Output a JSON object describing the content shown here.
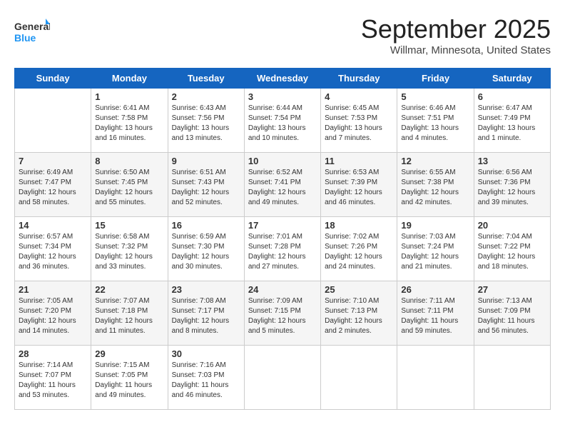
{
  "header": {
    "logo_general": "General",
    "logo_blue": "Blue",
    "month_title": "September 2025",
    "location": "Willmar, Minnesota, United States"
  },
  "days_of_week": [
    "Sunday",
    "Monday",
    "Tuesday",
    "Wednesday",
    "Thursday",
    "Friday",
    "Saturday"
  ],
  "weeks": [
    [
      {
        "date": "",
        "sunrise": "",
        "sunset": "",
        "daylight": ""
      },
      {
        "date": "1",
        "sunrise": "Sunrise: 6:41 AM",
        "sunset": "Sunset: 7:58 PM",
        "daylight": "Daylight: 13 hours and 16 minutes."
      },
      {
        "date": "2",
        "sunrise": "Sunrise: 6:43 AM",
        "sunset": "Sunset: 7:56 PM",
        "daylight": "Daylight: 13 hours and 13 minutes."
      },
      {
        "date": "3",
        "sunrise": "Sunrise: 6:44 AM",
        "sunset": "Sunset: 7:54 PM",
        "daylight": "Daylight: 13 hours and 10 minutes."
      },
      {
        "date": "4",
        "sunrise": "Sunrise: 6:45 AM",
        "sunset": "Sunset: 7:53 PM",
        "daylight": "Daylight: 13 hours and 7 minutes."
      },
      {
        "date": "5",
        "sunrise": "Sunrise: 6:46 AM",
        "sunset": "Sunset: 7:51 PM",
        "daylight": "Daylight: 13 hours and 4 minutes."
      },
      {
        "date": "6",
        "sunrise": "Sunrise: 6:47 AM",
        "sunset": "Sunset: 7:49 PM",
        "daylight": "Daylight: 13 hours and 1 minute."
      }
    ],
    [
      {
        "date": "7",
        "sunrise": "Sunrise: 6:49 AM",
        "sunset": "Sunset: 7:47 PM",
        "daylight": "Daylight: 12 hours and 58 minutes."
      },
      {
        "date": "8",
        "sunrise": "Sunrise: 6:50 AM",
        "sunset": "Sunset: 7:45 PM",
        "daylight": "Daylight: 12 hours and 55 minutes."
      },
      {
        "date": "9",
        "sunrise": "Sunrise: 6:51 AM",
        "sunset": "Sunset: 7:43 PM",
        "daylight": "Daylight: 12 hours and 52 minutes."
      },
      {
        "date": "10",
        "sunrise": "Sunrise: 6:52 AM",
        "sunset": "Sunset: 7:41 PM",
        "daylight": "Daylight: 12 hours and 49 minutes."
      },
      {
        "date": "11",
        "sunrise": "Sunrise: 6:53 AM",
        "sunset": "Sunset: 7:39 PM",
        "daylight": "Daylight: 12 hours and 46 minutes."
      },
      {
        "date": "12",
        "sunrise": "Sunrise: 6:55 AM",
        "sunset": "Sunset: 7:38 PM",
        "daylight": "Daylight: 12 hours and 42 minutes."
      },
      {
        "date": "13",
        "sunrise": "Sunrise: 6:56 AM",
        "sunset": "Sunset: 7:36 PM",
        "daylight": "Daylight: 12 hours and 39 minutes."
      }
    ],
    [
      {
        "date": "14",
        "sunrise": "Sunrise: 6:57 AM",
        "sunset": "Sunset: 7:34 PM",
        "daylight": "Daylight: 12 hours and 36 minutes."
      },
      {
        "date": "15",
        "sunrise": "Sunrise: 6:58 AM",
        "sunset": "Sunset: 7:32 PM",
        "daylight": "Daylight: 12 hours and 33 minutes."
      },
      {
        "date": "16",
        "sunrise": "Sunrise: 6:59 AM",
        "sunset": "Sunset: 7:30 PM",
        "daylight": "Daylight: 12 hours and 30 minutes."
      },
      {
        "date": "17",
        "sunrise": "Sunrise: 7:01 AM",
        "sunset": "Sunset: 7:28 PM",
        "daylight": "Daylight: 12 hours and 27 minutes."
      },
      {
        "date": "18",
        "sunrise": "Sunrise: 7:02 AM",
        "sunset": "Sunset: 7:26 PM",
        "daylight": "Daylight: 12 hours and 24 minutes."
      },
      {
        "date": "19",
        "sunrise": "Sunrise: 7:03 AM",
        "sunset": "Sunset: 7:24 PM",
        "daylight": "Daylight: 12 hours and 21 minutes."
      },
      {
        "date": "20",
        "sunrise": "Sunrise: 7:04 AM",
        "sunset": "Sunset: 7:22 PM",
        "daylight": "Daylight: 12 hours and 18 minutes."
      }
    ],
    [
      {
        "date": "21",
        "sunrise": "Sunrise: 7:05 AM",
        "sunset": "Sunset: 7:20 PM",
        "daylight": "Daylight: 12 hours and 14 minutes."
      },
      {
        "date": "22",
        "sunrise": "Sunrise: 7:07 AM",
        "sunset": "Sunset: 7:18 PM",
        "daylight": "Daylight: 12 hours and 11 minutes."
      },
      {
        "date": "23",
        "sunrise": "Sunrise: 7:08 AM",
        "sunset": "Sunset: 7:17 PM",
        "daylight": "Daylight: 12 hours and 8 minutes."
      },
      {
        "date": "24",
        "sunrise": "Sunrise: 7:09 AM",
        "sunset": "Sunset: 7:15 PM",
        "daylight": "Daylight: 12 hours and 5 minutes."
      },
      {
        "date": "25",
        "sunrise": "Sunrise: 7:10 AM",
        "sunset": "Sunset: 7:13 PM",
        "daylight": "Daylight: 12 hours and 2 minutes."
      },
      {
        "date": "26",
        "sunrise": "Sunrise: 7:11 AM",
        "sunset": "Sunset: 7:11 PM",
        "daylight": "Daylight: 11 hours and 59 minutes."
      },
      {
        "date": "27",
        "sunrise": "Sunrise: 7:13 AM",
        "sunset": "Sunset: 7:09 PM",
        "daylight": "Daylight: 11 hours and 56 minutes."
      }
    ],
    [
      {
        "date": "28",
        "sunrise": "Sunrise: 7:14 AM",
        "sunset": "Sunset: 7:07 PM",
        "daylight": "Daylight: 11 hours and 53 minutes."
      },
      {
        "date": "29",
        "sunrise": "Sunrise: 7:15 AM",
        "sunset": "Sunset: 7:05 PM",
        "daylight": "Daylight: 11 hours and 49 minutes."
      },
      {
        "date": "30",
        "sunrise": "Sunrise: 7:16 AM",
        "sunset": "Sunset: 7:03 PM",
        "daylight": "Daylight: 11 hours and 46 minutes."
      },
      {
        "date": "",
        "sunrise": "",
        "sunset": "",
        "daylight": ""
      },
      {
        "date": "",
        "sunrise": "",
        "sunset": "",
        "daylight": ""
      },
      {
        "date": "",
        "sunrise": "",
        "sunset": "",
        "daylight": ""
      },
      {
        "date": "",
        "sunrise": "",
        "sunset": "",
        "daylight": ""
      }
    ]
  ]
}
